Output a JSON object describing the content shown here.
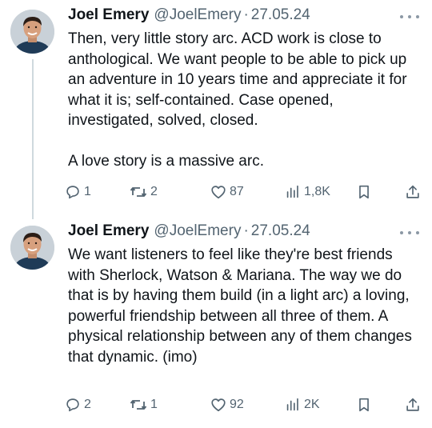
{
  "tweets": [
    {
      "author_name": "Joel Emery",
      "handle": "@JoelEmery",
      "separator": "·",
      "date": "27.05.24",
      "paragraphs": [
        "Then, very little story arc. ACD work is close to anthological. We want people to be able to pick up an adventure in 10 years time and appreciate it for what it is; self-contained. Case opened, investigated, solved, closed.",
        "A love story is a massive arc."
      ],
      "actions": {
        "replies": "1",
        "reposts": "2",
        "likes": "87",
        "views": "1,8K"
      }
    },
    {
      "author_name": "Joel Emery",
      "handle": "@JoelEmery",
      "separator": "·",
      "date": "27.05.24",
      "paragraphs": [
        "We want listeners to feel like they're best friends with Sherlock, Watson & Mariana. The way we do that is by having them build (in a light arc) a loving, powerful friendship between all three of them. A physical relationship between any of them changes that dynamic. (imo)"
      ],
      "actions": {
        "replies": "2",
        "reposts": "1",
        "likes": "92",
        "views": "2K"
      }
    }
  ],
  "icons": {
    "reply": "speech-bubble-icon",
    "repost": "repost-arrows-icon",
    "like": "heart-icon",
    "views": "bar-chart-icon",
    "bookmark": "bookmark-icon",
    "share": "share-upload-icon",
    "more": "more-dots-icon"
  },
  "colors": {
    "text": "#0f1419",
    "secondary": "#536471",
    "thread_line": "#cfd9de"
  }
}
